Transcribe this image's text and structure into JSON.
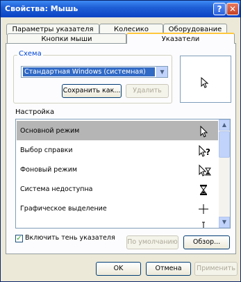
{
  "window": {
    "title": "Свойства: Мышь",
    "help_glyph": "?",
    "close_glyph": "✕"
  },
  "tabs": [
    {
      "label": "Параметры указателя"
    },
    {
      "label": "Колесико"
    },
    {
      "label": "Оборудование"
    },
    {
      "label": "Кнопки мыши"
    },
    {
      "label": "Указатели",
      "active": true
    }
  ],
  "scheme": {
    "group_label": "Схема",
    "selected": "Стандартная Windows (системная)",
    "save_button": "Сохранить как...",
    "delete_button": "Удалить"
  },
  "settings": {
    "label": "Настройка",
    "items": [
      {
        "label": "Основной режим",
        "icon": "arrow-cursor-icon",
        "selected": true
      },
      {
        "label": "Выбор справки",
        "icon": "help-select-cursor-icon"
      },
      {
        "label": "Фоновый режим",
        "icon": "working-in-background-cursor-icon"
      },
      {
        "label": "Система недоступна",
        "icon": "busy-hourglass-cursor-icon"
      },
      {
        "label": "Графическое выделение",
        "icon": "precision-select-cursor-icon"
      }
    ]
  },
  "options": {
    "shadow_label": "Включить тень указателя",
    "shadow_checked": true,
    "default_button": "По умолчанию",
    "browse_button": "Обзор..."
  },
  "footer": {
    "ok": "OK",
    "cancel": "Отмена",
    "apply": "Применить"
  }
}
